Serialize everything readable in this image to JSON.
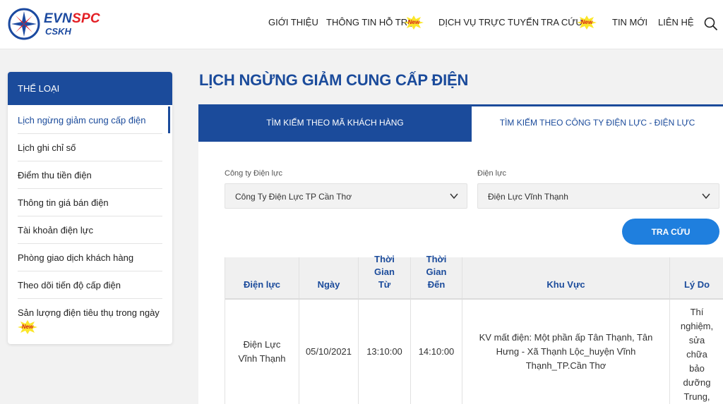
{
  "brand": {
    "name_main": "EVN",
    "name_accent": "SPC",
    "subtitle": "CSKH"
  },
  "nav": {
    "items": [
      "GIỚI THIỆU",
      "THÔNG TIN HỖ TRỢ",
      "DỊCH VỤ TRỰC TUYẾN",
      "TRA CỨU",
      "TIN MỚI",
      "LIÊN HỆ"
    ],
    "new_badge": "New"
  },
  "sidebar": {
    "heading": "THỂ LOẠI",
    "items": [
      "Lịch ngừng giảm cung cấp điện",
      "Lịch ghi chỉ số",
      "Điểm thu tiền điện",
      "Thông tin giá bán điện",
      "Tài khoản điện lực",
      "Phòng giao dịch khách hàng",
      "Theo dõi tiến độ cấp điện",
      "Sản lượng điện tiêu thụ trong ngày"
    ],
    "new_badge": "New"
  },
  "main": {
    "title": "LỊCH NGỪNG GIẢM CUNG CẤP ĐIỆN",
    "tabs": [
      "TÌM KIẾM THEO MÃ KHÁCH HÀNG",
      "TÌM KIẾM THEO CÔNG TY ĐIỆN LỰC - ĐIỆN LỰC"
    ],
    "form": {
      "company_label": "Công ty Điện lực",
      "company_value": "Công Ty Điện Lực TP Cần Thơ",
      "branch_label": "Điện lực",
      "branch_value": "Điện Lực Vĩnh Thạnh",
      "search_button": "TRA CỨU"
    },
    "table": {
      "headers": [
        "Điện lực",
        "Ngày",
        "Thời Gian Từ",
        "Thời Gian Đến",
        "Khu Vực",
        "Lý Do"
      ],
      "rows": [
        [
          "Điện Lực Vĩnh Thạnh",
          "05/10/2021",
          "13:10:00",
          "14:10:00",
          "KV mất điện: Một phần ấp Tân Thạnh, Tân Hưng - Xã Thạnh Lộc_huyện Vĩnh Thạnh_TP.Cần Thơ",
          "Thí nghiệm, sửa chữa bảo dưỡng Trung, hạ"
        ]
      ]
    }
  },
  "colors": {
    "primary": "#1b4b9b",
    "button": "#1f7fde",
    "accent_red": "#e31e24"
  }
}
